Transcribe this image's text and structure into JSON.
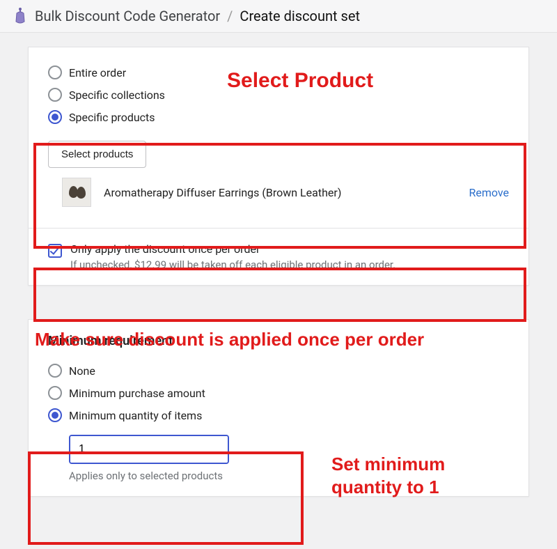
{
  "breadcrumb": {
    "app": "Bulk Discount Code Generator",
    "sep": "/",
    "current": "Create discount set"
  },
  "applies_to": {
    "options": {
      "entire": "Entire order",
      "collections": "Specific collections",
      "products": "Specific products"
    },
    "selected": "products",
    "select_btn": "Select products",
    "product": {
      "name": "Aromatherapy Diffuser Earrings (Brown Leather)",
      "remove": "Remove"
    }
  },
  "once_per_order": {
    "label": "Only apply the discount once per order",
    "checked": true,
    "helper": "If unchecked, $12.99 will be taken off each eligible product in an order."
  },
  "min_req": {
    "title": "Minimum requirement",
    "options": {
      "none": "None",
      "amount": "Minimum purchase amount",
      "qty": "Minimum quantity of items"
    },
    "selected": "qty",
    "qty_value": "1",
    "helper": "Applies only to selected products"
  },
  "annotations": {
    "select_product": "Select Product",
    "once": "Make sure discount is applied once per order",
    "set_min": "Set minimum quantity to 1"
  }
}
